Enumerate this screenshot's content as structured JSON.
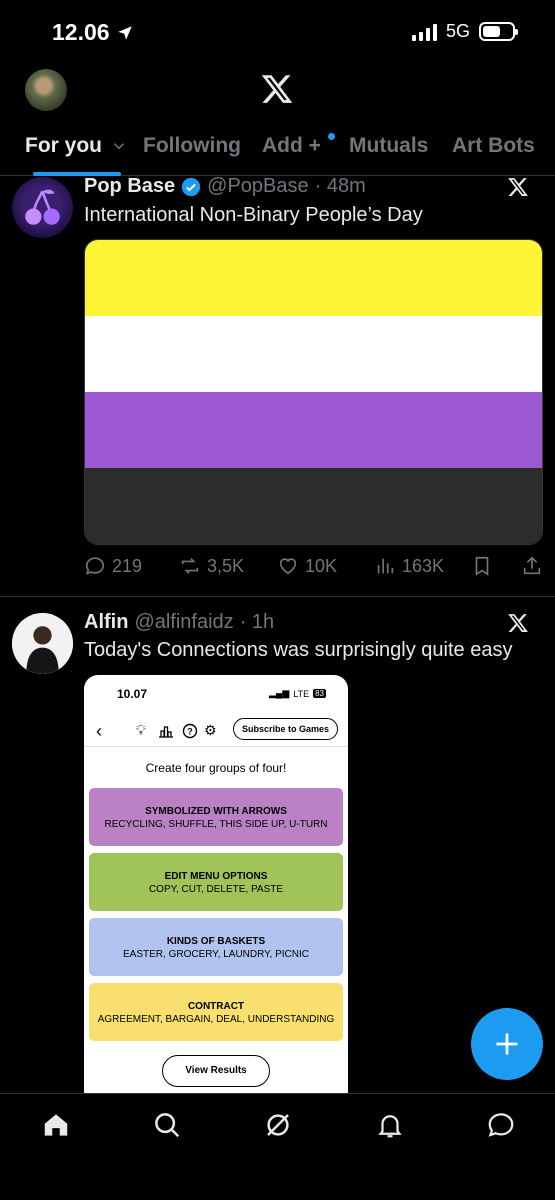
{
  "status_bar": {
    "time": "12.06",
    "network": "5G"
  },
  "tabs": [
    {
      "label": "For you"
    },
    {
      "label": "Following"
    },
    {
      "label": "Add +"
    },
    {
      "label": "Mutuals"
    },
    {
      "label": "Art Bots"
    }
  ],
  "tweets": [
    {
      "name": "Pop Base",
      "handle": "@PopBase",
      "time": "· 48m",
      "text": "International Non-Binary People’s Day",
      "flag_colors": [
        "#fcf434",
        "#ffffff",
        "#9c59d1",
        "#2c2c2c"
      ],
      "stats": {
        "replies": "219",
        "reposts": "3,5K",
        "likes": "10K",
        "views": "163K"
      }
    },
    {
      "name": "Alfin",
      "handle": "@alfinfaidz",
      "time": "· 1h",
      "text": "Today's Connections was surprisingly quite easy",
      "screenshot": {
        "time": "10.07",
        "network": "LTE",
        "battery": "83",
        "subscribe_label": "Subscribe to Games",
        "prompt": "Create four groups of four!",
        "groups": [
          {
            "title": "SYMBOLIZED WITH ARROWS",
            "words": "RECYCLING, SHUFFLE, THIS SIDE UP, U-TURN",
            "color": "#ba81c5"
          },
          {
            "title": "EDIT MENU OPTIONS",
            "words": "COPY, CUT, DELETE, PASTE",
            "color": "#a0c35a"
          },
          {
            "title": "KINDS OF BASKETS",
            "words": "EASTER, GROCERY, LAUNDRY, PICNIC",
            "color": "#b0c4ef"
          },
          {
            "title": "CONTRACT",
            "words": "AGREEMENT, BARGAIN, DEAL, UNDERSTANDING",
            "color": "#f9df6d"
          }
        ],
        "view_results_label": "View Results"
      }
    }
  ],
  "colors": {
    "accent": "#1d9bf0",
    "background": "#000000",
    "muted": "#71767b",
    "text": "#e7e9ea"
  }
}
